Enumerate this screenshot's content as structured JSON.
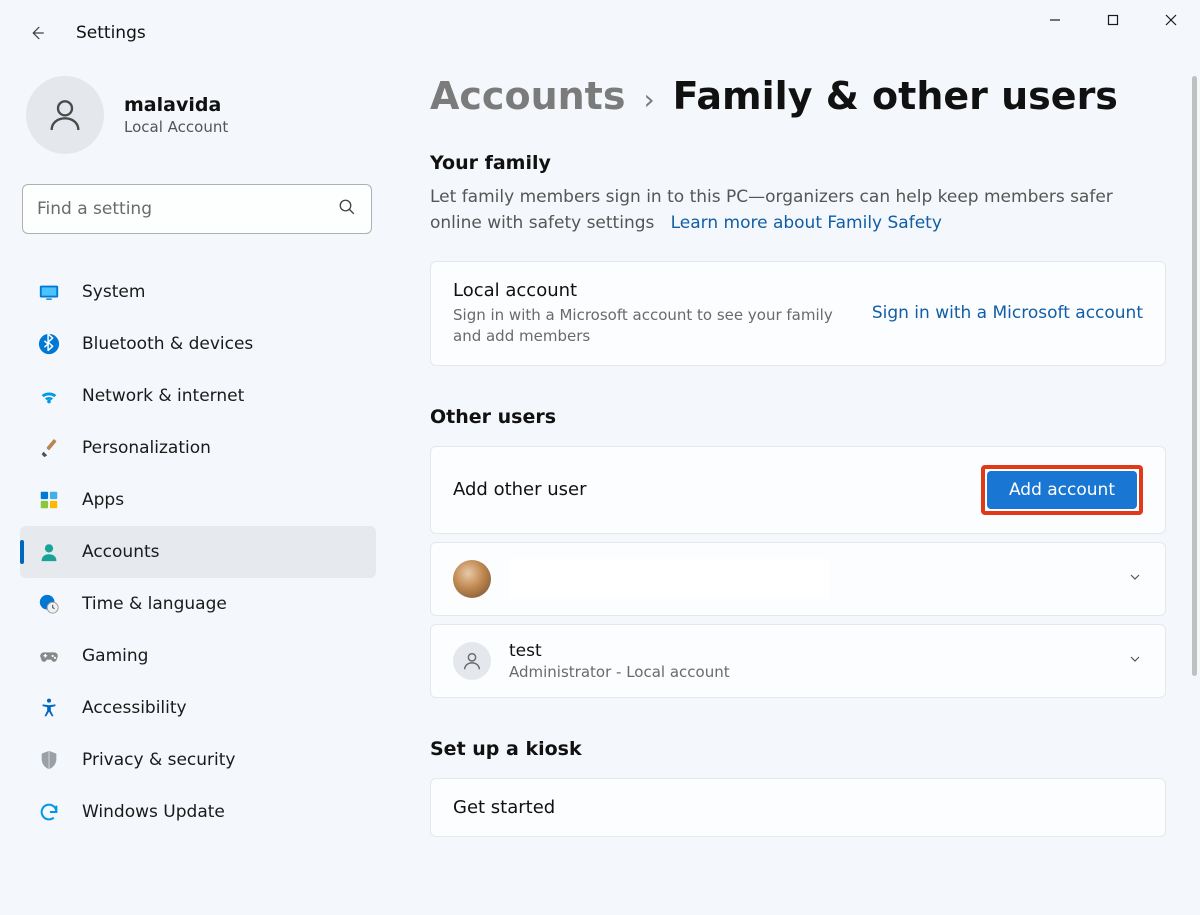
{
  "app": {
    "title": "Settings"
  },
  "user": {
    "name": "malavida",
    "type": "Local Account"
  },
  "search": {
    "placeholder": "Find a setting"
  },
  "sidebar": {
    "items": [
      {
        "label": "System",
        "icon": "system-icon",
        "active": false
      },
      {
        "label": "Bluetooth & devices",
        "icon": "bluetooth-icon",
        "active": false
      },
      {
        "label": "Network & internet",
        "icon": "wifi-icon",
        "active": false
      },
      {
        "label": "Personalization",
        "icon": "brush-icon",
        "active": false
      },
      {
        "label": "Apps",
        "icon": "apps-icon",
        "active": false
      },
      {
        "label": "Accounts",
        "icon": "person-icon",
        "active": true
      },
      {
        "label": "Time & language",
        "icon": "clock-icon",
        "active": false
      },
      {
        "label": "Gaming",
        "icon": "gamepad-icon",
        "active": false
      },
      {
        "label": "Accessibility",
        "icon": "accessibility-icon",
        "active": false
      },
      {
        "label": "Privacy & security",
        "icon": "shield-icon",
        "active": false
      },
      {
        "label": "Windows Update",
        "icon": "update-icon",
        "active": false
      }
    ]
  },
  "breadcrumb": {
    "parent": "Accounts",
    "page": "Family & other users"
  },
  "family": {
    "heading": "Your family",
    "desc": "Let family members sign in to this PC—organizers can help keep members safer online with safety settings",
    "link": "Learn more about Family Safety",
    "local_title": "Local account",
    "local_desc": "Sign in with a Microsoft account to see your family and add members",
    "signin_link": "Sign in with a Microsoft account"
  },
  "other": {
    "heading": "Other users",
    "add_label": "Add other user",
    "add_button": "Add account",
    "users": [
      {
        "name": "",
        "sub": "",
        "hasPhoto": true
      },
      {
        "name": "test",
        "sub": "Administrator - Local account",
        "hasPhoto": false
      }
    ]
  },
  "kiosk": {
    "heading": "Set up a kiosk",
    "cta": "Get started"
  },
  "colors": {
    "accent": "#0067c0",
    "button": "#1976d2",
    "highlight": "#e23a18"
  }
}
